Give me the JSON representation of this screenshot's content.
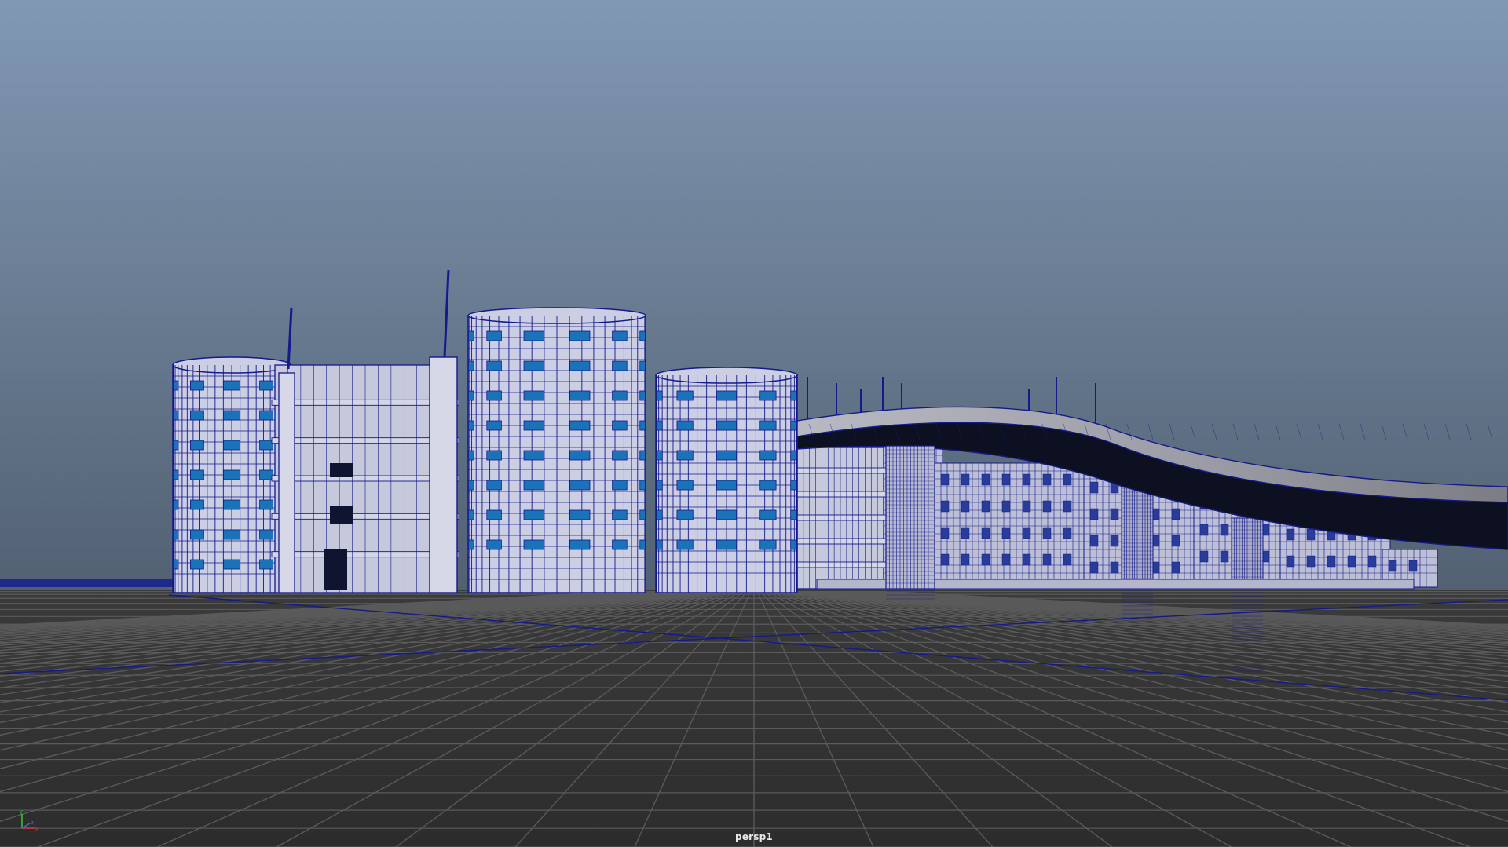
{
  "viewport": {
    "camera_label": "persp1"
  },
  "axis_gizmo": {
    "y_label": "y",
    "z_label": "z",
    "x_label": "x"
  },
  "colors": {
    "sky_top": "#8197b3",
    "sky_bottom": "#536273",
    "ground": "#353535",
    "grid_line": "#5a5a5a",
    "wire_edge": "#131a8a",
    "wall": "#cccfe4",
    "window": "#1a73b8",
    "axis_x": "#d23a3a",
    "axis_y": "#3bbf3b",
    "axis_z": "#3b6bd2"
  }
}
